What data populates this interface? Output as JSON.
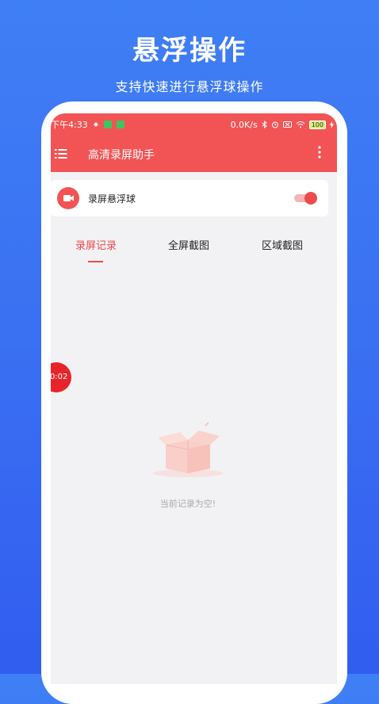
{
  "promo": {
    "headline": "悬浮操作",
    "subline": "支持快速进行悬浮球操作"
  },
  "status_bar": {
    "time": "下午4:33",
    "net_speed": "0.0K/s",
    "battery": "100"
  },
  "toolbar": {
    "title": "高清录屏助手"
  },
  "float_card": {
    "label": "录屏悬浮球",
    "toggle_on": true
  },
  "tabs": [
    {
      "label": "录屏记录",
      "active": true
    },
    {
      "label": "全屏截图",
      "active": false
    },
    {
      "label": "区域截图",
      "active": false
    }
  ],
  "floating_ball": {
    "timer": "00:02"
  },
  "empty_state": {
    "text": "当前记录为空!"
  },
  "colors": {
    "accent": "#f25455",
    "background": "#3f7ff5"
  }
}
